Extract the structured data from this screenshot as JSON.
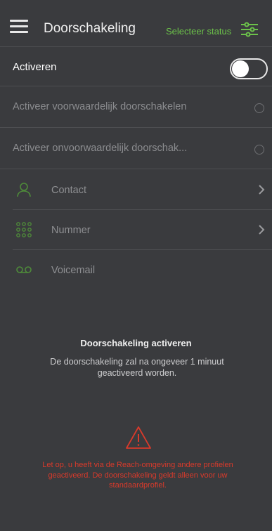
{
  "header": {
    "title": "Doorschakeling",
    "status_button": "Selecteer status"
  },
  "activate": {
    "label": "Activeren",
    "toggle_on": false
  },
  "options": [
    {
      "label": "Activeer voorwaardelijk doorschakelen",
      "selected": false
    },
    {
      "label": "Activeer onvoorwaardelijk doorschak...",
      "selected": false
    }
  ],
  "nav": [
    {
      "label": "Contact",
      "icon": "person-icon"
    },
    {
      "label": "Nummer",
      "icon": "keypad-icon"
    },
    {
      "label": "Voicemail",
      "icon": "voicemail-icon"
    }
  ],
  "info": {
    "title": "Doorschakeling activeren",
    "text": "De doorschakeling zal na ongeveer 1 minuut geactiveerd worden."
  },
  "warning": {
    "icon": "warning-icon",
    "text": "Let op, u heeft via de Reach-omgeving andere profielen geactiveerd. De doorschakeling geldt alleen voor uw standaardprofiel."
  },
  "colors": {
    "accent": "#6cc24a",
    "warning": "#d93a2b",
    "background": "#3a3b3e"
  }
}
